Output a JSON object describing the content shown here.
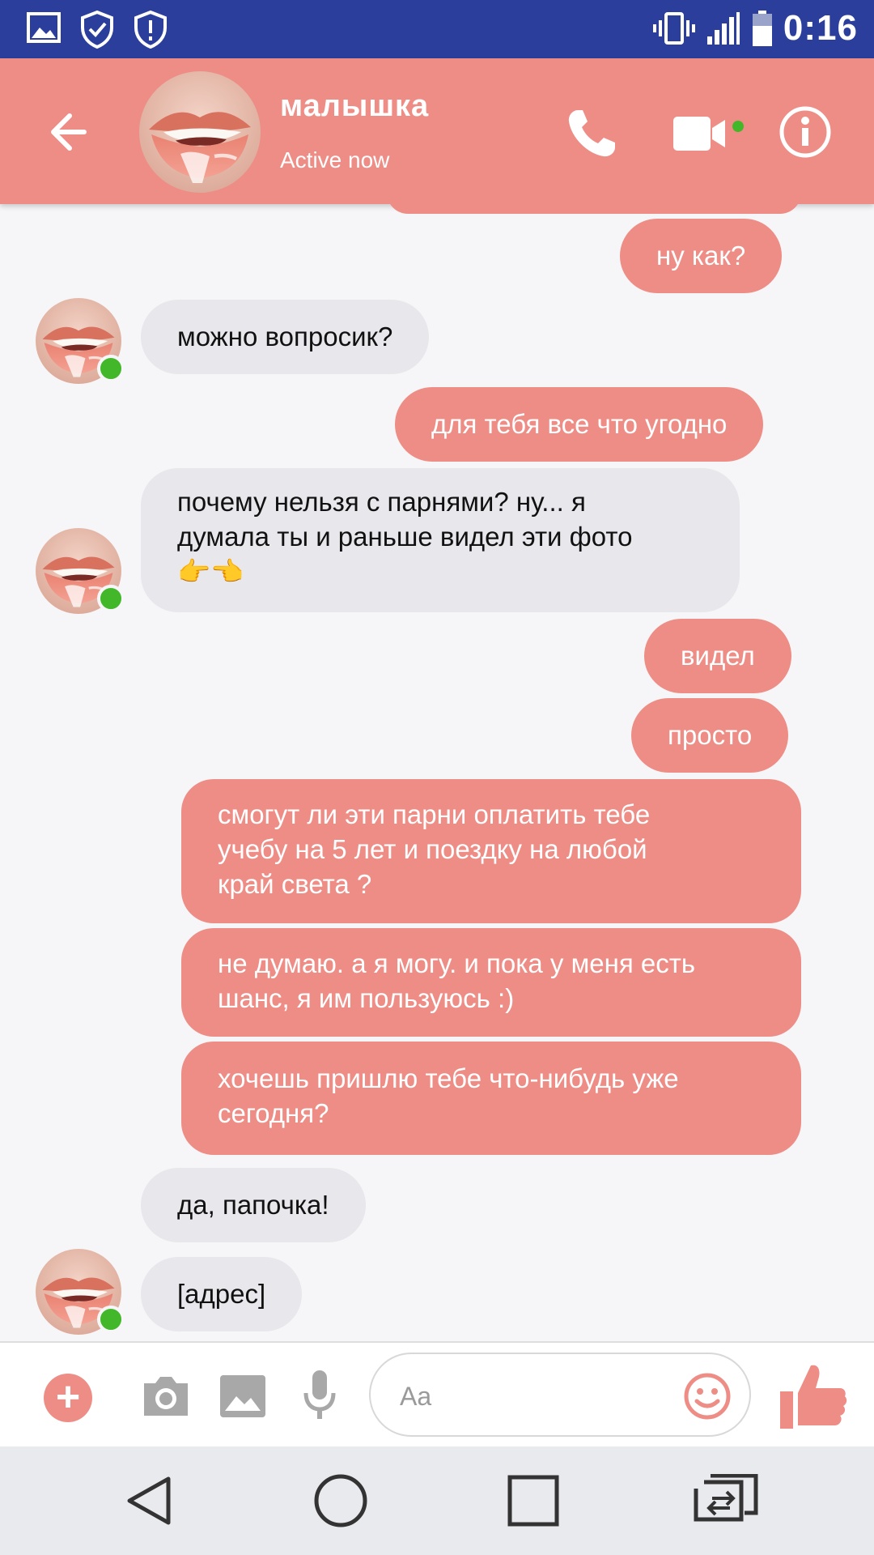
{
  "status_bar": {
    "time": "0:16",
    "left_icons": [
      "gallery-icon",
      "shield-check-icon",
      "shield-alert-icon"
    ],
    "right_icons": [
      "vibrate-icon",
      "signal-icon",
      "battery-icon"
    ]
  },
  "header": {
    "contact_name": "малышка",
    "contact_status": "Active now",
    "icons": [
      "back-arrow-icon",
      "phone-icon",
      "video-camera-icon",
      "info-icon"
    ],
    "accent_color": "#ee8d86"
  },
  "messages": [
    {
      "side": "out",
      "lines": [
        "ну как?"
      ]
    },
    {
      "side": "in",
      "lines": [
        "можно вопросик?"
      ]
    },
    {
      "side": "out",
      "lines": [
        "для тебя все что угодно"
      ]
    },
    {
      "side": "in",
      "lines": [
        "почему нельзя с парнями? ну... я",
        "думала ты и раньше видел эти фото",
        "👉👈"
      ]
    },
    {
      "side": "out",
      "lines": [
        "видел"
      ]
    },
    {
      "side": "out",
      "lines": [
        "просто"
      ]
    },
    {
      "side": "out",
      "lines": [
        "смогут ли эти парни оплатить тебе",
        "учебу на 5 лет и поездку на любой",
        "край света ?"
      ]
    },
    {
      "side": "out",
      "lines": [
        "не думаю. а я могу. и пока у меня есть",
        "шанс, я им пользуюсь :)"
      ]
    },
    {
      "side": "out",
      "lines": [
        "хочешь пришлю тебе что-нибудь уже",
        "сегодня?"
      ]
    },
    {
      "side": "in",
      "lines": [
        "да, папочка!"
      ]
    },
    {
      "side": "in",
      "lines": [
        "[адрес]"
      ]
    }
  ],
  "composer": {
    "placeholder": "Aa",
    "icons": [
      "plus-icon",
      "camera-icon",
      "image-icon",
      "microphone-icon",
      "emoji-icon",
      "thumbs-up-icon"
    ]
  },
  "nav_bar": {
    "icons": [
      "nav-back-icon",
      "nav-home-icon",
      "nav-recents-icon",
      "nav-switch-icon"
    ]
  },
  "colors": {
    "status_bar": "#2c3e9c",
    "outgoing_bubble": "#ee8d86",
    "incoming_bubble": "#e8e7ec",
    "online_indicator": "#42b72a"
  }
}
